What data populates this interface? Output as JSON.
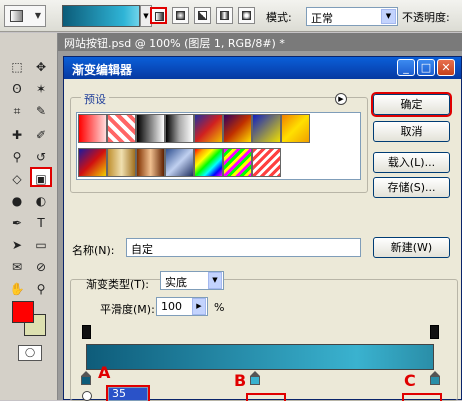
{
  "options_bar": {
    "mode_label": "模式:",
    "mode_value": "正常",
    "opacity_label": "不透明度:"
  },
  "document": {
    "tab_title": "网站按钮.psd @ 100% (图层 1, RGB/8#) *"
  },
  "colors": {
    "foreground": "#ff0000",
    "background": "#dde0b0",
    "gradient_left": "#0c5c79",
    "gradient_right": "#2fb4d6",
    "highlight": "#e00000"
  },
  "dialog": {
    "title": "渐变编辑器",
    "presets_label": "预设",
    "buttons": {
      "ok": "确定",
      "cancel": "取消",
      "load": "载入(L)...",
      "save": "存储(S)...",
      "new": "新建(W)"
    },
    "name_label": "名称(N):",
    "name_value": "自定",
    "gradient_type_label": "渐变类型(T):",
    "gradient_type_value": "实底",
    "smoothness_label": "平滑度(M):",
    "smoothness_value": "100",
    "smoothness_unit": "%",
    "stop_input_value": "35",
    "markers": [
      "A",
      "B",
      "C"
    ]
  }
}
